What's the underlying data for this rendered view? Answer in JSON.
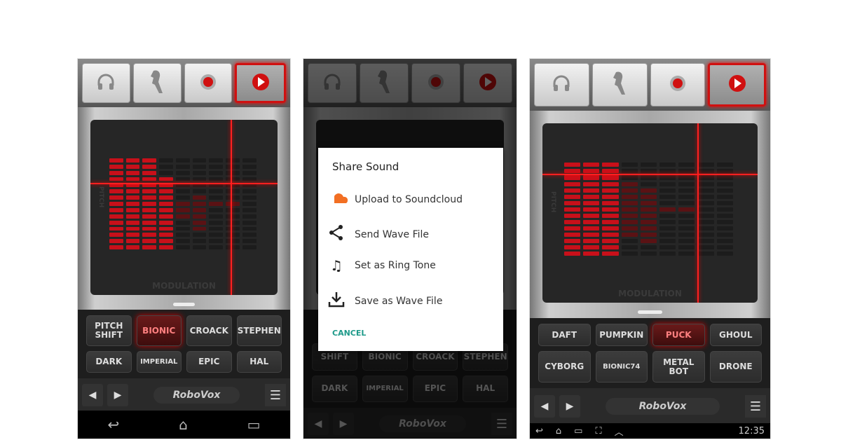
{
  "screens": [
    {
      "top_buttons": [
        {
          "icon": "headphones-icon"
        },
        {
          "icon": "parrot-icon"
        },
        {
          "icon": "record-icon"
        },
        {
          "icon": "play-icon",
          "active": true
        }
      ],
      "equalizer": {
        "levels": [
          15,
          15,
          15,
          12,
          0,
          0,
          0,
          0,
          0
        ],
        "dim_rows": [
          [],
          [],
          [],
          [],
          [
            7,
            8,
            9
          ],
          [
            6,
            7,
            8,
            9,
            10,
            11
          ],
          [
            7
          ],
          [
            7
          ],
          []
        ],
        "crosshair": {
          "modulation": 0.75,
          "pitch": 0.36
        }
      },
      "pitch_label": "PITCH",
      "modulation_label": "MODULATION",
      "presets": [
        "PITCH\nSHIFT",
        "BIONIC",
        "CROACK",
        "STEPHEN",
        "DARK",
        "IMPERIAL",
        "EPIC",
        "HAL"
      ],
      "selected_preset": "BIONIC",
      "brand": "RoboVox"
    },
    {
      "top_buttons": [
        {
          "icon": "headphones-icon"
        },
        {
          "icon": "parrot-icon"
        },
        {
          "icon": "record-icon"
        },
        {
          "icon": "play-icon"
        }
      ],
      "presets": [
        "SHIFT",
        "BIONIC",
        "CROACK",
        "STEPHEN",
        "DARK",
        "IMPERIAL",
        "EPIC",
        "HAL"
      ],
      "brand": "RoboVox",
      "dialog": {
        "title": "Share Sound",
        "items": [
          {
            "icon": "soundcloud-icon",
            "label": "Upload to Soundcloud",
            "color": "#f26f23"
          },
          {
            "icon": "share-icon",
            "label": "Send Wave File"
          },
          {
            "icon": "music-note-icon",
            "label": "Set as Ring Tone"
          },
          {
            "icon": "download-icon",
            "label": "Save as Wave File"
          }
        ],
        "cancel": "CANCEL"
      }
    },
    {
      "top_buttons": [
        {
          "icon": "headphones-icon"
        },
        {
          "icon": "parrot-icon"
        },
        {
          "icon": "record-icon"
        },
        {
          "icon": "play-icon",
          "active": true
        }
      ],
      "equalizer": {
        "levels": [
          15,
          15,
          15,
          0,
          0,
          0,
          0,
          0,
          0
        ],
        "dim_rows": [
          [],
          [],
          [],
          [
            3,
            4,
            5,
            6,
            7,
            8,
            9,
            10,
            11
          ],
          [
            4,
            5,
            6,
            7,
            8,
            9,
            10,
            11,
            12
          ],
          [
            7
          ],
          [
            7
          ],
          [],
          []
        ],
        "crosshair": {
          "modulation": 0.72,
          "pitch": 0.28
        }
      },
      "pitch_label": "PITCH",
      "modulation_label": "MODULATION",
      "presets": [
        "DAFT",
        "PUMPKIN",
        "PUCK",
        "GHOUL",
        "CYBORG",
        "BIONIC74",
        "METAL\nBOT",
        "DRONE"
      ],
      "selected_preset": "PUCK",
      "brand": "RoboVox",
      "status_bar": {
        "time": "12:35"
      }
    }
  ],
  "colors": {
    "accent": "#d01010",
    "dialog_accent": "#1e9a8a"
  }
}
